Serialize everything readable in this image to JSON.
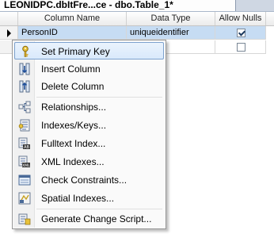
{
  "tab": {
    "title": "LEONIDPC.dbItFre...ce - dbo.Table_1*"
  },
  "grid": {
    "columns": [
      "Column Name",
      "Data Type",
      "Allow Nulls"
    ],
    "rows": [
      {
        "name": "PersonID",
        "type": "uniqueidentifier",
        "allow_nulls": true,
        "selected": true
      },
      {
        "name": "",
        "type": "",
        "allow_nulls": false,
        "selected": false
      }
    ]
  },
  "context_menu": {
    "items": [
      {
        "label": "Set Primary Key",
        "icon": "key-icon",
        "highlighted": true
      },
      {
        "label": "Insert Column",
        "icon": "insert-column-icon"
      },
      {
        "label": "Delete Column",
        "icon": "delete-column-icon"
      },
      {
        "label": "Relationships...",
        "icon": "relationships-icon"
      },
      {
        "label": "Indexes/Keys...",
        "icon": "indexes-keys-icon"
      },
      {
        "label": "Fulltext Index...",
        "icon": "fulltext-index-icon"
      },
      {
        "label": "XML Indexes...",
        "icon": "xml-indexes-icon"
      },
      {
        "label": "Check Constraints...",
        "icon": "check-constraints-icon"
      },
      {
        "label": "Spatial Indexes...",
        "icon": "spatial-indexes-icon"
      },
      {
        "label": "Generate Change Script...",
        "icon": "generate-script-icon"
      }
    ]
  }
}
